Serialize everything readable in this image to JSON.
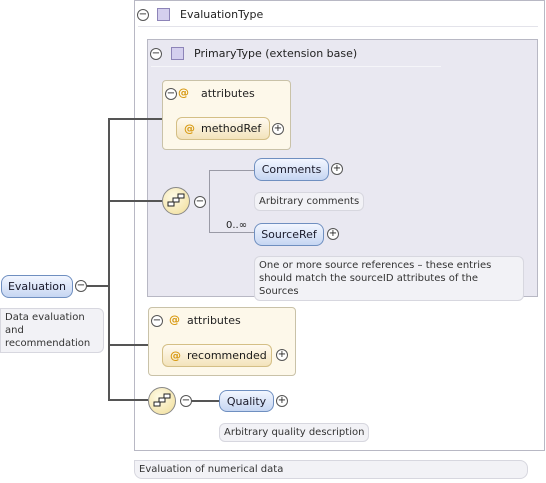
{
  "root": {
    "name": "Evaluation",
    "doc": [
      "Data evaluation",
      "and",
      "recommendation"
    ]
  },
  "evaluation_type": {
    "name": "EvaluationType",
    "doc": "Evaluation of numerical data"
  },
  "primary_type": {
    "name": "PrimaryType (extension base)"
  },
  "attributes_primary": {
    "label": "attributes",
    "items": [
      "methodRef"
    ]
  },
  "sequence_primary": {
    "comments": {
      "name": "Comments",
      "doc": "Arbitrary comments"
    },
    "sourceref": {
      "name": "SourceRef",
      "cardinality": "0..∞",
      "doc": [
        "One or more source references – these entries",
        "should match the sourceID attributes of the Sources"
      ]
    }
  },
  "attributes_eval": {
    "label": "attributes",
    "items": [
      "recommended"
    ]
  },
  "quality": {
    "name": "Quality",
    "doc": "Arbitrary quality description"
  },
  "icons": {
    "collapse": "⊖",
    "expand": "+",
    "attribute": "@"
  }
}
